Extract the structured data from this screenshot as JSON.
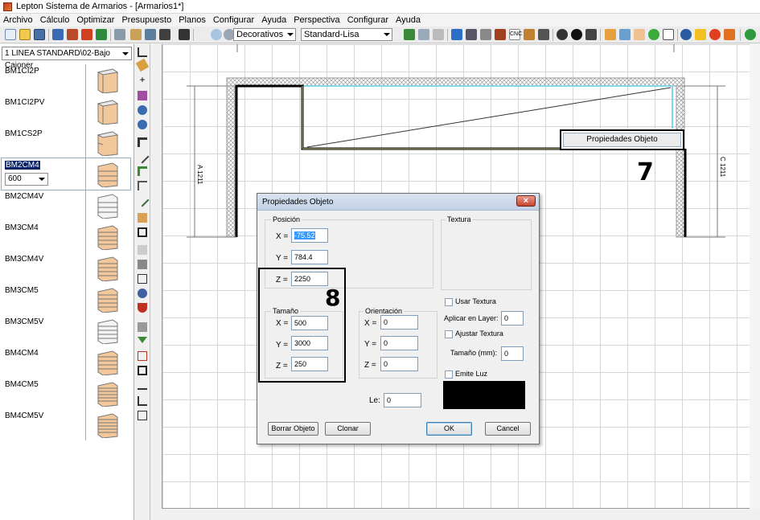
{
  "window": {
    "title": "Lepton Sistema de Armarios - [Armarios1*]"
  },
  "menu": [
    "Archivo",
    "Cálculo",
    "Optimizar",
    "Presupuesto",
    "Planos",
    "Configurar",
    "Ayuda",
    "Perspectiva",
    "Configurar",
    "Ayuda"
  ],
  "toolbar": {
    "material_filter": "Decorativos",
    "finish": "Standard-Lisa"
  },
  "left_panel": {
    "family": "1 LINEA STANDARD\\02-Bajo Cajoner",
    "modules": [
      {
        "name": "BM1CI2P"
      },
      {
        "name": "BM1CI2PV"
      },
      {
        "name": "BM1CS2P"
      },
      {
        "name": "BM2CM4",
        "selected": true,
        "size": "600"
      },
      {
        "name": "BM2CM4V"
      },
      {
        "name": "BM3CM4"
      },
      {
        "name": "BM3CM4V"
      },
      {
        "name": "BM3CM5"
      },
      {
        "name": "BM3CM5V"
      },
      {
        "name": "BM4CM4"
      },
      {
        "name": "BM4CM5"
      },
      {
        "name": "BM4CM5V"
      }
    ]
  },
  "canvas": {
    "dim_left": "A 1211",
    "dim_right": "C 1211",
    "context_menu_item": "Propiedades Objeto",
    "step7": "7",
    "step8": "8"
  },
  "dialog": {
    "title": "Propiedades Objeto",
    "position_label": "Posición",
    "x_label": "X =",
    "x_value": "-75.52",
    "y_label": "Y =",
    "y_value": "784.4",
    "z_label": "Z =",
    "z_value": "2250",
    "size_label": "Tamaño",
    "sx_value": "500",
    "sy_value": "3000",
    "sz_value": "250",
    "orientation_label": "Orientación",
    "ox_value": "0",
    "oy_value": "0",
    "oz_value": "0",
    "texture_label": "Textura",
    "use_texture": "Usar Textura",
    "apply_layer_label": "Aplicar en Layer:",
    "apply_layer_value": "0",
    "fit_texture": "Ajustar Textura",
    "texture_size_label": "Tamaño (mm):",
    "texture_size_value": "0",
    "emit_light": "Emite Luz",
    "le_label": "Le:",
    "le_value": "0",
    "delete_button": "Borrar Objeto",
    "clone_button": "Clonar",
    "ok_button": "OK",
    "cancel_button": "Cancel"
  }
}
